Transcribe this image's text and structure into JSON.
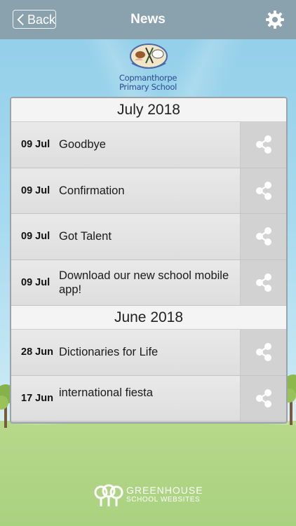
{
  "header": {
    "back_label": "Back",
    "title": "News"
  },
  "school": {
    "name_line1": "Copmanthorpe",
    "name_line2": "Primary School"
  },
  "months": [
    {
      "label": "July 2018",
      "items": [
        {
          "date": "09 Jul",
          "title": "Goodbye"
        },
        {
          "date": "09 Jul",
          "title": "Confirmation"
        },
        {
          "date": "09 Jul",
          "title": "Got Talent"
        },
        {
          "date": "09 Jul",
          "title": "Download our new school mobile app!"
        }
      ]
    },
    {
      "label": "June 2018",
      "items": [
        {
          "date": "28 Jun",
          "title": "Dictionaries for Life"
        },
        {
          "date": "17 Jun",
          "title": "international fiesta"
        }
      ]
    }
  ],
  "footer": {
    "brand_line1": "GREENHOUSE",
    "brand_line2": "SCHOOL WEBSITES"
  },
  "icons": {
    "back": "chevron-left-icon",
    "settings": "gear-icon",
    "share": "share-icon"
  },
  "colors": {
    "header_bg": "#8aa2ad",
    "sky": "#a9dbef",
    "grass": "#a9d27f"
  }
}
